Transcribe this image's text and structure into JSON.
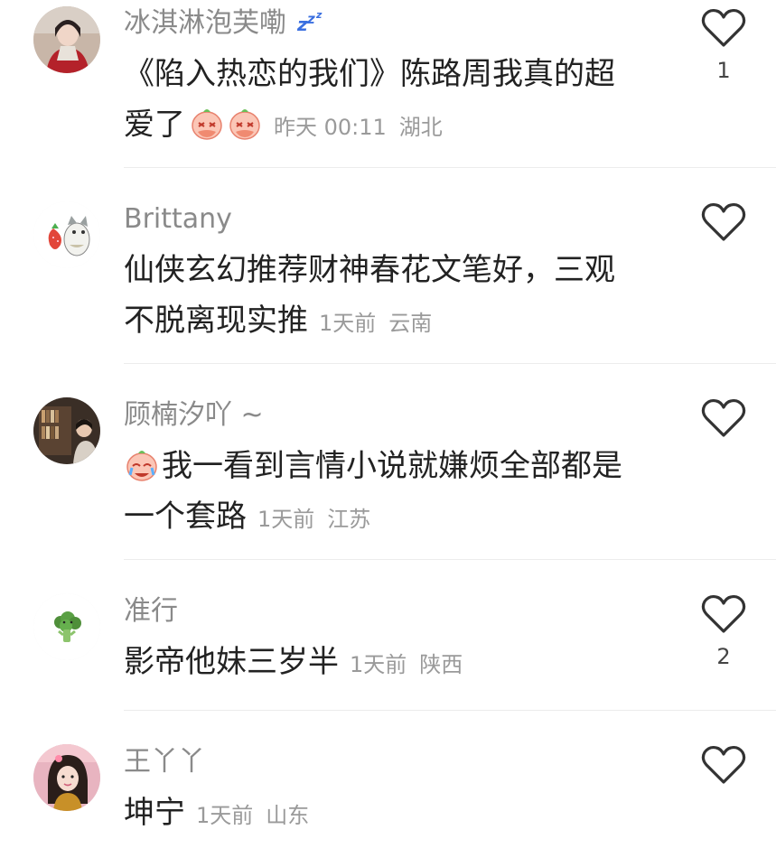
{
  "comments": [
    {
      "username": "冰淇淋泡芙嘞",
      "username_suffix": "zzz",
      "text": "《陷入热恋的我们》陈路周我真的超爱了",
      "text_line1": "《陷入热恋的我们》陈路周我真的超",
      "text_line2": "爱了",
      "time": "昨天 00:11",
      "location": "湖北",
      "like_count": "1",
      "avatar": "woman-red-scarf"
    },
    {
      "username": "Brittany",
      "text_line1": "仙侠玄幻推荐财神春花文笔好，三观",
      "text_line2": "不脱离现实推",
      "time": "1天前",
      "location": "云南",
      "like_count": "",
      "avatar": "cat-strawberry"
    },
    {
      "username": "顾楠汐吖 ~",
      "text_line1": "我一看到言情小说就嫌烦全部都是",
      "text_line2": "一个套路",
      "time": "1天前",
      "location": "江苏",
      "like_count": "",
      "avatar": "bookshelf-person"
    },
    {
      "username": "准行",
      "text_line1": "影帝他妹三岁半",
      "time": "1天前",
      "location": "陕西",
      "like_count": "2",
      "avatar": "broccoli"
    },
    {
      "username": "王丫丫",
      "text_line1": "坤宁",
      "time": "1天前",
      "location": "山东",
      "like_count": "",
      "avatar": "girl-portrait"
    }
  ],
  "icons": {
    "like": "heart-outline-icon",
    "cry_emoji": "crying-peach-emoji",
    "sleep": "zzz-icon"
  },
  "colors": {
    "username": "#8a8a8a",
    "body_text": "#222222",
    "meta": "#9a9a9a",
    "heart_stroke": "#333333",
    "divider": "#ececec"
  }
}
